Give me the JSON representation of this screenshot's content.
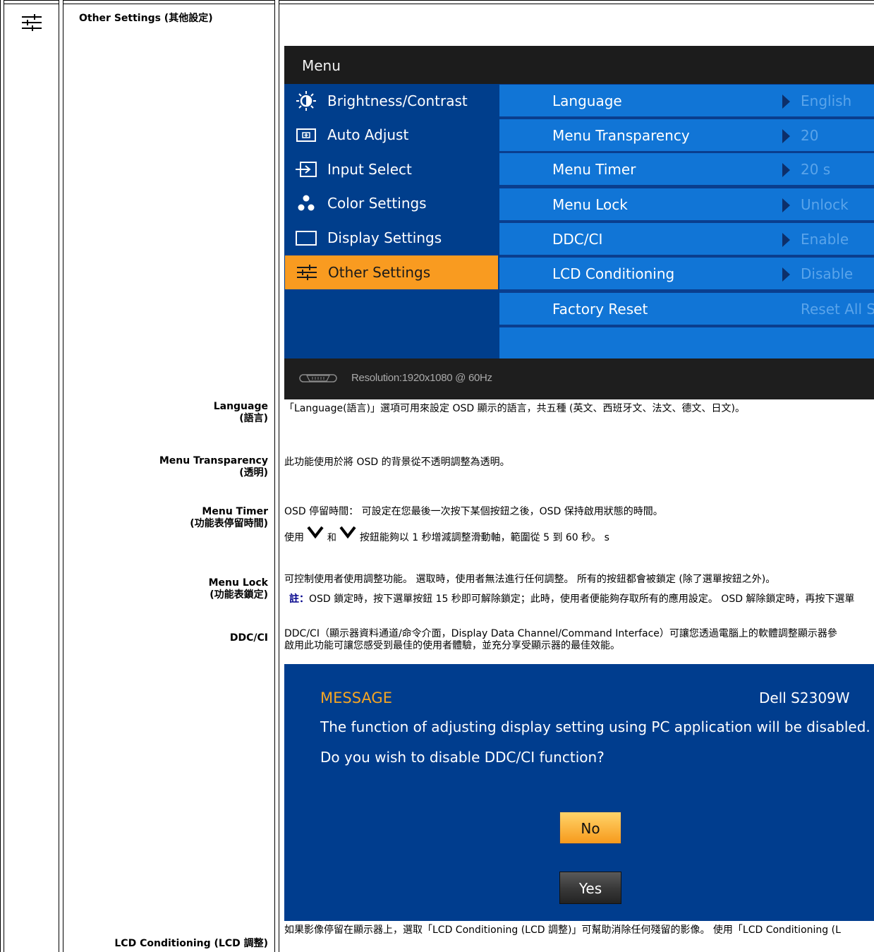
{
  "section": {
    "title": "Other Settings (其他設定)",
    "icon": "sliders-icon"
  },
  "osd": {
    "title": "Menu",
    "left_items": [
      {
        "label": "Brightness/Contrast",
        "icon": "brightness-icon"
      },
      {
        "label": "Auto Adjust",
        "icon": "auto-adjust-icon"
      },
      {
        "label": "Input Select",
        "icon": "input-select-icon"
      },
      {
        "label": "Color Settings",
        "icon": "color-settings-icon"
      },
      {
        "label": "Display Settings",
        "icon": "display-settings-icon"
      },
      {
        "label": "Other Settings",
        "icon": "other-settings-icon",
        "selected": true
      }
    ],
    "right_rows": [
      {
        "label": "Language",
        "value": "English"
      },
      {
        "label": "Menu Transparency",
        "value": "20"
      },
      {
        "label": "Menu Timer",
        "value": "20 s"
      },
      {
        "label": "Menu Lock",
        "value": "Unlock"
      },
      {
        "label": "DDC/CI",
        "value": "Enable"
      },
      {
        "label": "LCD Conditioning",
        "value": "Disable"
      },
      {
        "label": "Factory Reset",
        "value": "Reset All S"
      }
    ],
    "footer": "Resolution:1920x1080 @ 60Hz",
    "colors": {
      "selected": "#f99b20",
      "right_row": "#1175d6",
      "panel": "#003e8c",
      "header": "#1c1c1c"
    }
  },
  "rows": {
    "language": {
      "label1": "Language",
      "label2": "(語言)",
      "desc": "「Language(語言)」選項可用來設定 OSD 顯示的語言，共五種 (英文、西班牙文、法文、德文、日文)。"
    },
    "transparency": {
      "label1": "Menu Transparency",
      "label2": "(透明)",
      "desc": "此功能使用於將 OSD 的背景從不透明調整為透明。"
    },
    "timer": {
      "label1": "Menu Timer",
      "label2": "(功能表停留時間)",
      "desc1": "OSD 停留時間： 可設定在您最後一次按下某個按鈕之後，OSD 保持啟用狀態的時間。",
      "desc2_a": "使用",
      "desc2_b": "和",
      "desc2_c": "按鈕能夠以 1 秒增減調整滑動軸，範圍從 5 到 60 秒。 s"
    },
    "lock": {
      "label1": "Menu Lock",
      "label2": "(功能表鎖定)",
      "desc1": "可控制使用者使用調整功能。 選取時，使用者無法進行任何調整。 所有的按鈕都會被鎖定 (除了選單按鈕之外)。",
      "note_label": "註：",
      "note": "OSD 鎖定時，按下選單按鈕 15 秒即可解除鎖定；此時，使用者便能夠存取所有的應用設定。 OSD 解除鎖定時，再按下選單"
    },
    "ddcci": {
      "label1": "DDC/CI",
      "desc1": "DDC/CI（顯示器資料通道/命令介面，Display Data Channel/Command Interface）可讓您透過電腦上的軟體調整顯示器參",
      "desc2": "啟用此功能可讓您感受到最佳的使用者體驗，並充分享受顯示器的最佳效能。"
    },
    "lcd": {
      "label1": "LCD Conditioning (LCD 調整)",
      "desc1": "如果影像停留在顯示器上，選取「LCD Conditioning (LCD 調整)」可幫助消除任何殘留的影像。 使用「LCD Conditioning (L"
    }
  },
  "dialog": {
    "title": "MESSAGE",
    "model": "Dell S2309W",
    "line1": "The function of adjusting display setting using PC application will be disabled.",
    "line2": "Do you wish to disable DDC/CI function?",
    "no": "No",
    "yes": "Yes",
    "colors": {
      "background": "#003d8e",
      "title": "#f5a623"
    }
  }
}
